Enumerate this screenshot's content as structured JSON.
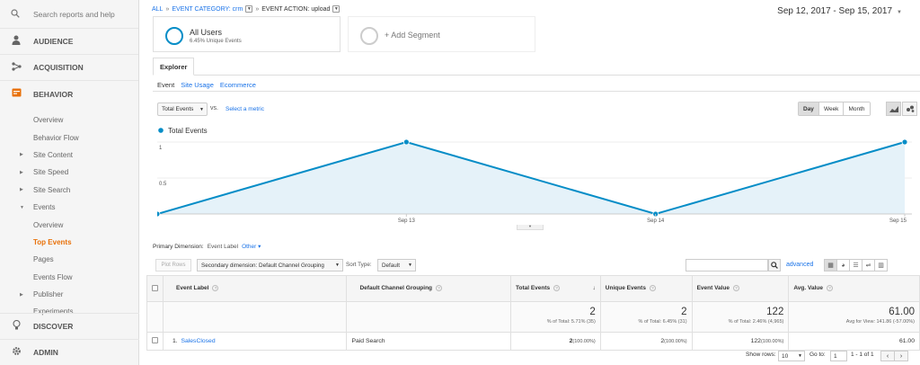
{
  "sidebar": {
    "search_placeholder": "Search reports and help",
    "sections": [
      {
        "label": "AUDIENCE",
        "icon": "person-icon"
      },
      {
        "label": "ACQUISITION",
        "icon": "acquisition-icon"
      },
      {
        "label": "BEHAVIOR",
        "icon": "behavior-icon"
      }
    ],
    "behavior_items": [
      {
        "label": "Overview"
      },
      {
        "label": "Behavior Flow"
      },
      {
        "label": "Site Content"
      },
      {
        "label": "Site Speed"
      },
      {
        "label": "Site Search"
      },
      {
        "label": "Events"
      },
      {
        "label": "Overview"
      },
      {
        "label": "Top Events"
      },
      {
        "label": "Pages"
      },
      {
        "label": "Events Flow"
      },
      {
        "label": "Publisher"
      },
      {
        "label": "Experiments"
      }
    ],
    "discover": "DISCOVER",
    "admin": "ADMIN"
  },
  "breadcrumb": {
    "all": "ALL",
    "category": "EVENT CATEGORY: crm",
    "action": "EVENT ACTION: upload"
  },
  "date_range": "Sep 12, 2017 - Sep 15, 2017",
  "segments": {
    "all_users": "All Users",
    "all_users_sub": "6.45% Unique Events",
    "add_segment": "+ Add Segment"
  },
  "tabs": {
    "explorer": "Explorer",
    "subtabs": [
      "Event",
      "Site Usage",
      "Ecommerce"
    ]
  },
  "chart_controls": {
    "metric": "Total Events",
    "vs": "vs.",
    "select_metric": "Select a metric",
    "day": "Day",
    "week": "Week",
    "month": "Month"
  },
  "chart_data": {
    "type": "area",
    "x": [
      "Sep 12",
      "Sep 13",
      "Sep 14",
      "Sep 15"
    ],
    "series": [
      {
        "name": "Total Events",
        "values": [
          0,
          1,
          0,
          1
        ]
      }
    ],
    "x_tick_labels": [
      "Sep 13",
      "Sep 14",
      "Sep 15"
    ],
    "y_tick_labels": [
      "1",
      "0.5"
    ],
    "ylim": [
      0,
      1
    ],
    "grid": true,
    "color": "#058dc7",
    "fill": "#e5f2f9"
  },
  "dimension": {
    "label": "Primary Dimension:",
    "current": "Event Label",
    "other": "Other"
  },
  "table_controls": {
    "plot_rows": "Plot Rows",
    "secondary_dim": "Secondary dimension: Default Channel Grouping",
    "sort_type_label": "Sort Type:",
    "sort_type": "Default",
    "advanced": "advanced"
  },
  "table": {
    "headers": [
      "Event Label",
      "Default Channel Grouping",
      "Total Events",
      "Unique Events",
      "Event Value",
      "Avg. Value"
    ],
    "totals": [
      {
        "value": "2",
        "sub": "% of Total: 5.71% (35)"
      },
      {
        "value": "2",
        "sub": "% of Total: 6.45% (31)"
      },
      {
        "value": "122",
        "sub": "% of Total: 2.46% (4,965)"
      },
      {
        "value": "61.00",
        "sub": "Avg for View: 141.86 (-57.00%)"
      }
    ],
    "rows": [
      {
        "index": "1.",
        "label": "SalesClosed",
        "channel": "Paid Search",
        "total": "2",
        "total_pct": "(100.00%)",
        "unique": "2",
        "unique_pct": "(100.00%)",
        "value": "122",
        "value_pct": "(100.00%)",
        "avg": "61.00"
      }
    ]
  },
  "footer": {
    "show_rows": "Show rows:",
    "rows_value": "10",
    "goto": "Go to:",
    "goto_value": "1",
    "range": "1 - 1 of 1"
  }
}
